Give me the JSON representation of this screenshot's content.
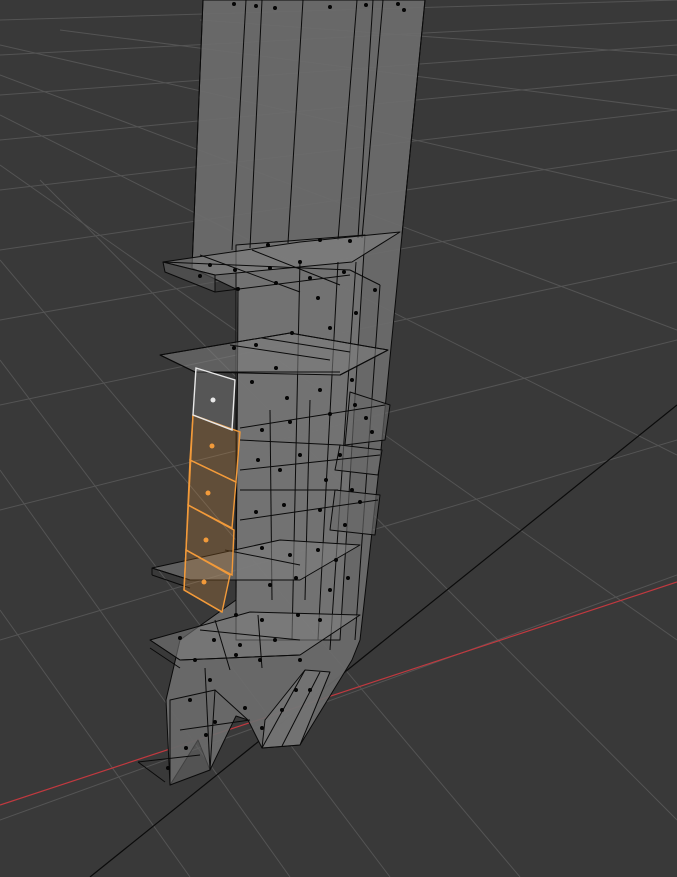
{
  "viewport": {
    "background_color": "#393939",
    "grid_color": "#545454",
    "x_axis_color": "#c0393f",
    "mesh_face_color": "#6e6e6e",
    "mesh_edge_color": "#0a0a0a",
    "vertex_color": "#000000",
    "selection_color": "#f29a3a",
    "active_selection_color": "#ffffff",
    "mode": "edit-mode-face-select",
    "selected_face_count": 4,
    "active_face_count": 1
  }
}
